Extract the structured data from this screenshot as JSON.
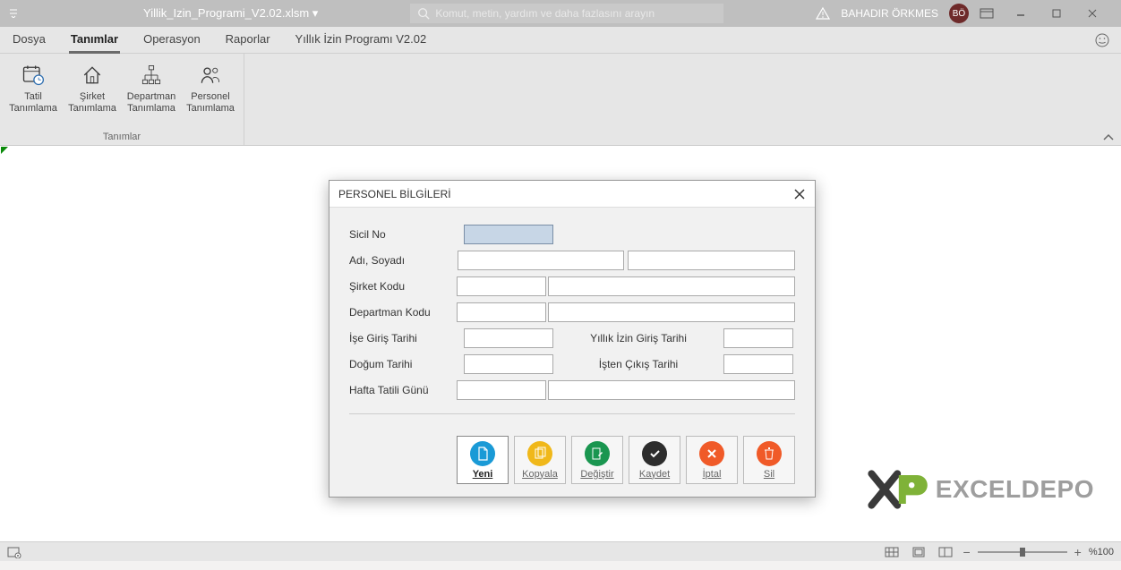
{
  "titlebar": {
    "filename": "Yillik_Izin_Programi_V2.02.xlsm ▾",
    "search_placeholder": "Komut, metin, yardım ve daha fazlasını arayın",
    "username": "BAHADIR ÖRKMES",
    "avatar": "BÖ"
  },
  "menu": {
    "tabs": [
      "Dosya",
      "Tanımlar",
      "Operasyon",
      "Raporlar",
      "Yıllık İzin Programı V2.02"
    ],
    "active": 1
  },
  "ribbon": {
    "group_title": "Tanımlar",
    "items": [
      {
        "label": "Tatil\nTanımlama"
      },
      {
        "label": "Şirket\nTanımlama"
      },
      {
        "label": "Departman\nTanımlama"
      },
      {
        "label": "Personel\nTanımlama"
      }
    ]
  },
  "dialog": {
    "title": "PERSONEL BİLGİLERİ",
    "labels": {
      "sicil": "Sicil No",
      "ad": "Adı, Soyadı",
      "sirket": "Şirket Kodu",
      "dept": "Departman Kodu",
      "ise_giris": "İşe Giriş Tarihi",
      "yillik_izin": "Yıllık İzin Giriş Tarihi",
      "dogum": "Doğum Tarihi",
      "isten_cikis": "İşten Çıkış Tarihi",
      "hafta_tatil": "Hafta Tatili Günü"
    },
    "buttons": {
      "yeni": "Yeni",
      "kopyala": "Kopyala",
      "degistir": "Değiştir",
      "kaydet": "Kaydet",
      "iptal": "İptal",
      "sil": "Sil"
    }
  },
  "statusbar": {
    "zoom": "%100"
  },
  "watermark": {
    "text": "EXCELDEPO"
  },
  "colors": {
    "yeni": "#1a9ad6",
    "kopyala": "#f0b81a",
    "degistir": "#1a9650",
    "kaydet": "#2d2d2d",
    "iptal": "#f05a28",
    "sil": "#f05a28"
  }
}
